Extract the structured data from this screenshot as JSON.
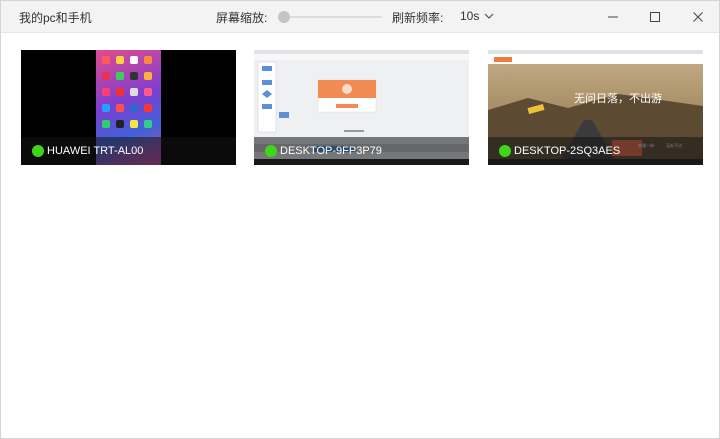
{
  "window": {
    "title": "我的pc和手机",
    "zoom_label": "屏幕缩放:",
    "zoom_level": 0.0,
    "refresh_label": "刷新频率:",
    "refresh_value": "10s"
  },
  "devices": [
    {
      "name": "HUAWEI TRT-AL00",
      "status": "online",
      "status_color": "#3fd61a"
    },
    {
      "name": "DESKTOP-9FP3P79",
      "status": "online",
      "status_color": "#3fd61a"
    },
    {
      "name": "DESKTOP-2SQ3AES",
      "status": "online",
      "status_color": "#3fd61a"
    }
  ],
  "thumbnails": {
    "desktop3_headline": "无问日落，不出游",
    "desktop3_button_a": "软键一体",
    "desktop3_button_b": "无处不达"
  }
}
